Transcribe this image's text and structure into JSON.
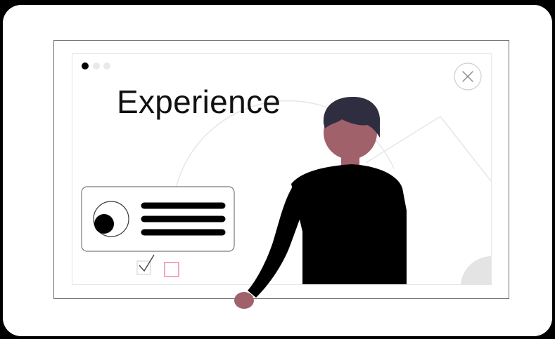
{
  "slide": {
    "title": "Experience"
  },
  "pager": {
    "total": 3,
    "active": 1
  },
  "colors": {
    "background": "#000000",
    "card": "#ffffff",
    "frame_border": "#6b6b6b",
    "skin": "#a0616a",
    "hair": "#2f2e41",
    "body": "#000000",
    "accent_checkbox": "#f48fb1",
    "light_line": "#e6e6e6",
    "light_shape": "#e4e4e4"
  },
  "icons": {
    "close": "close-icon",
    "check": "checkmark-icon",
    "checkbox": "checkbox-icon",
    "avatar": "avatar-icon"
  }
}
